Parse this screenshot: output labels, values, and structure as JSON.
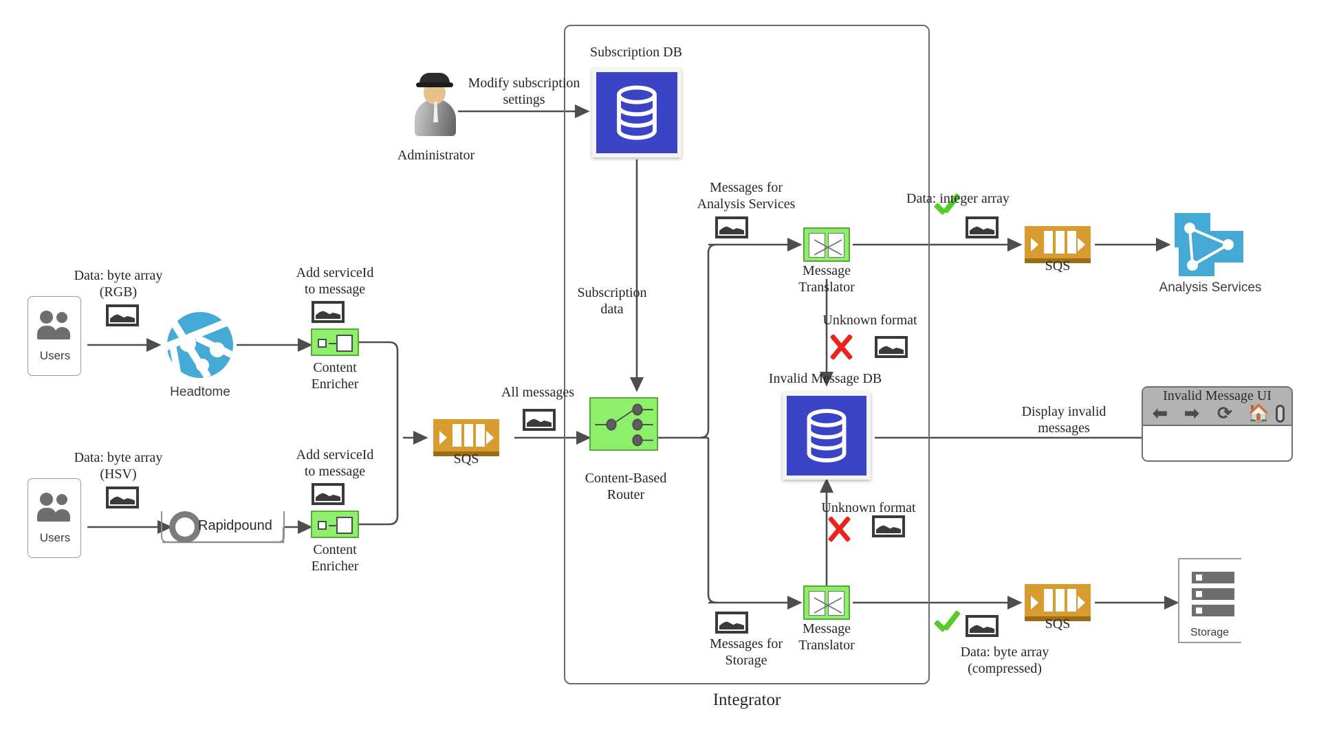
{
  "diagram": {
    "title": "Integrator",
    "boundary_label": "Integrator"
  },
  "left_flow": {
    "users_top_label": "Users",
    "users_bottom_label": "Users",
    "data_rgb_label": "Data: byte array\n(RGB)",
    "data_hsv_label": "Data: byte array\n(HSV)",
    "headtome_label": "Headtome",
    "rapidpound_label": "Rapidpound",
    "enricher_top_annotation": "Add serviceId\nto message",
    "enricher_bottom_annotation": "Add serviceId\nto message",
    "enricher_top_label": "Content\nEnricher",
    "enricher_bottom_label": "Content\nEnricher",
    "sqs_in_label": "SQS",
    "all_messages_label": "All messages"
  },
  "admin_flow": {
    "administrator_label": "Administrator",
    "modify_subscription_label": "Modify subscription\nsettings",
    "subscription_db_label": "Subscription DB",
    "subscription_data_label": "Subscription\ndata"
  },
  "router": {
    "label": "Content-Based\nRouter"
  },
  "top_branch": {
    "messages_for_analysis_label": "Messages for\nAnalysis Services",
    "translator_label": "Message\nTranslator",
    "unknown_format_label": "Unknown format",
    "data_integer_array_label": "Data: integer array",
    "sqs_label": "SQS",
    "analysis_services_label": "Analysis Services"
  },
  "bottom_branch": {
    "messages_for_storage_label": "Messages for\nStorage",
    "translator_label": "Message\nTranslator",
    "unknown_format_label": "Unknown format",
    "data_byte_array_label": "Data: byte array\n(compressed)",
    "sqs_label": "SQS",
    "storage_label": "Storage"
  },
  "invalid": {
    "invalid_message_db_label": "Invalid Message DB",
    "display_invalid_label": "Display invalid\nmessages",
    "ui_title": "Invalid Message UI",
    "ui_back_icon": "back-arrow-icon",
    "ui_forward_icon": "forward-arrow-icon",
    "ui_reload_icon": "reload-icon",
    "ui_home_icon": "home-icon",
    "ui_address_icon": "address-bar-pill"
  },
  "colors": {
    "eip_green": "#8ef06a",
    "sqs_orange": "#d79b30",
    "db_blue": "#3b44c4",
    "azure_blue": "#45a9d6",
    "check_green": "#55cc2a",
    "cross_red": "#e8241c",
    "wire": "#4d4d4d"
  }
}
